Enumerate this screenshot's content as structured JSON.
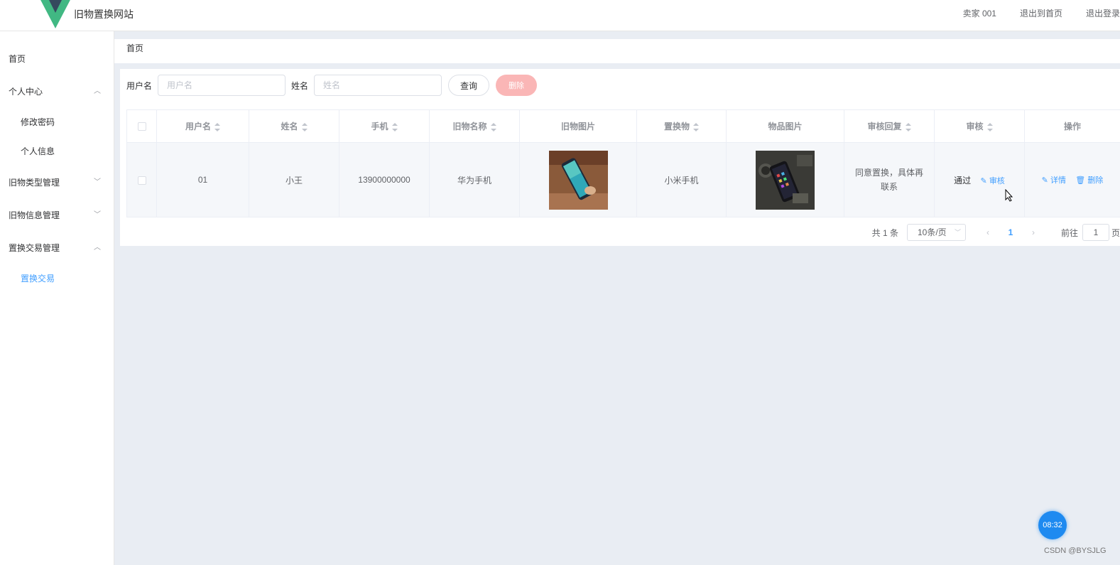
{
  "header": {
    "site_title": "旧物置换网站",
    "user_label": "卖家 001",
    "back_home": "退出到首页",
    "logout": "退出登录",
    "logo_colors": [
      "#41b883",
      "#35495e"
    ]
  },
  "sidebar": {
    "items": [
      {
        "label": "首页"
      },
      {
        "label": "个人中心",
        "expanded": true,
        "children": [
          "修改密码",
          "个人信息"
        ]
      },
      {
        "label": "旧物类型管理",
        "expanded": false
      },
      {
        "label": "旧物信息管理",
        "expanded": false
      },
      {
        "label": "置换交易管理",
        "expanded": true,
        "children": [
          "置换交易"
        ],
        "active_child": "置换交易"
      }
    ]
  },
  "breadcrumb": "首页",
  "search": {
    "username_label": "用户名",
    "username_placeholder": "用户名",
    "name_label": "姓名",
    "name_placeholder": "姓名",
    "query_button": "查询",
    "delete_button": "删除"
  },
  "table": {
    "columns": [
      "用户名",
      "姓名",
      "手机",
      "旧物名称",
      "旧物图片",
      "置换物",
      "物品图片",
      "审核回复",
      "审核",
      "操作"
    ],
    "rows": [
      {
        "username": "01",
        "name": "小王",
        "phone": "13900000000",
        "old_item": "华为手机",
        "old_image": "phone-photo",
        "exchange_item": "小米手机",
        "item_image": "phone-photo",
        "review_reply": "同意置换，具体再联系",
        "review_status": "通过",
        "review_action": "审核",
        "detail_action": "详情",
        "delete_action": "删除"
      }
    ]
  },
  "pagination": {
    "total": "共 1 条",
    "page_size": "10条/页",
    "current_page": "1",
    "goto_label": "前往",
    "goto_value": "1",
    "goto_unit": "页"
  },
  "overlay": {
    "clock": "08:32",
    "watermark": "CSDN @BYSJLG"
  },
  "colors": {
    "primary": "#409eff",
    "danger_light": "#fab6b6",
    "main_bg": "#e9edf3"
  }
}
